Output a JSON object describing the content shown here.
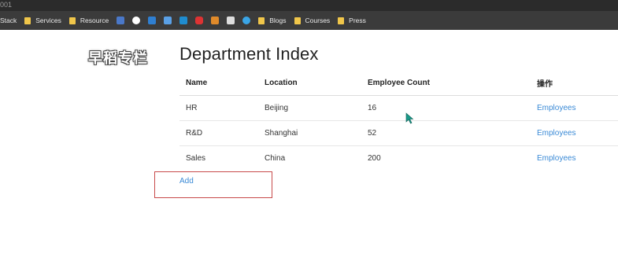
{
  "window": {
    "title_fragment": "001"
  },
  "bookmarks": [
    {
      "label": "Stack",
      "icon": "folder-icon"
    },
    {
      "label": "Services",
      "icon": "folder-icon"
    },
    {
      "label": "Resource",
      "icon": "folder-icon"
    },
    {
      "label": "",
      "icon": "site-icon-1",
      "color": "#4a78c9"
    },
    {
      "label": "",
      "icon": "google-icon",
      "color": "#ffffff"
    },
    {
      "label": "",
      "icon": "site-icon-2",
      "color": "#2f7fd1"
    },
    {
      "label": "",
      "icon": "site-icon-3",
      "color": "#5aa0e6"
    },
    {
      "label": "",
      "icon": "bing-icon",
      "color": "#1f8ccf"
    },
    {
      "label": "",
      "icon": "youtube-icon",
      "color": "#d33"
    },
    {
      "label": "",
      "icon": "site-icon-4",
      "color": "#e08a2a"
    },
    {
      "label": "",
      "icon": "wiki-icon",
      "color": "#ddd"
    },
    {
      "label": "",
      "icon": "twitter-icon",
      "color": "#3aa5e6"
    },
    {
      "label": "Blogs",
      "icon": "folder-icon"
    },
    {
      "label": "Courses",
      "icon": "folder-icon"
    },
    {
      "label": "Press",
      "icon": "folder-icon"
    }
  ],
  "logo": {
    "text": "早稻专栏"
  },
  "page": {
    "title": "Department Index",
    "table": {
      "headers": [
        "Name",
        "Location",
        "Employee Count",
        "操作"
      ],
      "rows": [
        {
          "name": "HR",
          "location": "Beijing",
          "count": "16",
          "action": "Employees"
        },
        {
          "name": "R&D",
          "location": "Shanghai",
          "count": "52",
          "action": "Employees"
        },
        {
          "name": "Sales",
          "location": "China",
          "count": "200",
          "action": "Employees"
        }
      ]
    },
    "add_link": "Add"
  },
  "colors": {
    "link": "#3a8ad6",
    "highlight_border": "#c84a4a",
    "bookmark_bar": "#3b3b3b"
  }
}
